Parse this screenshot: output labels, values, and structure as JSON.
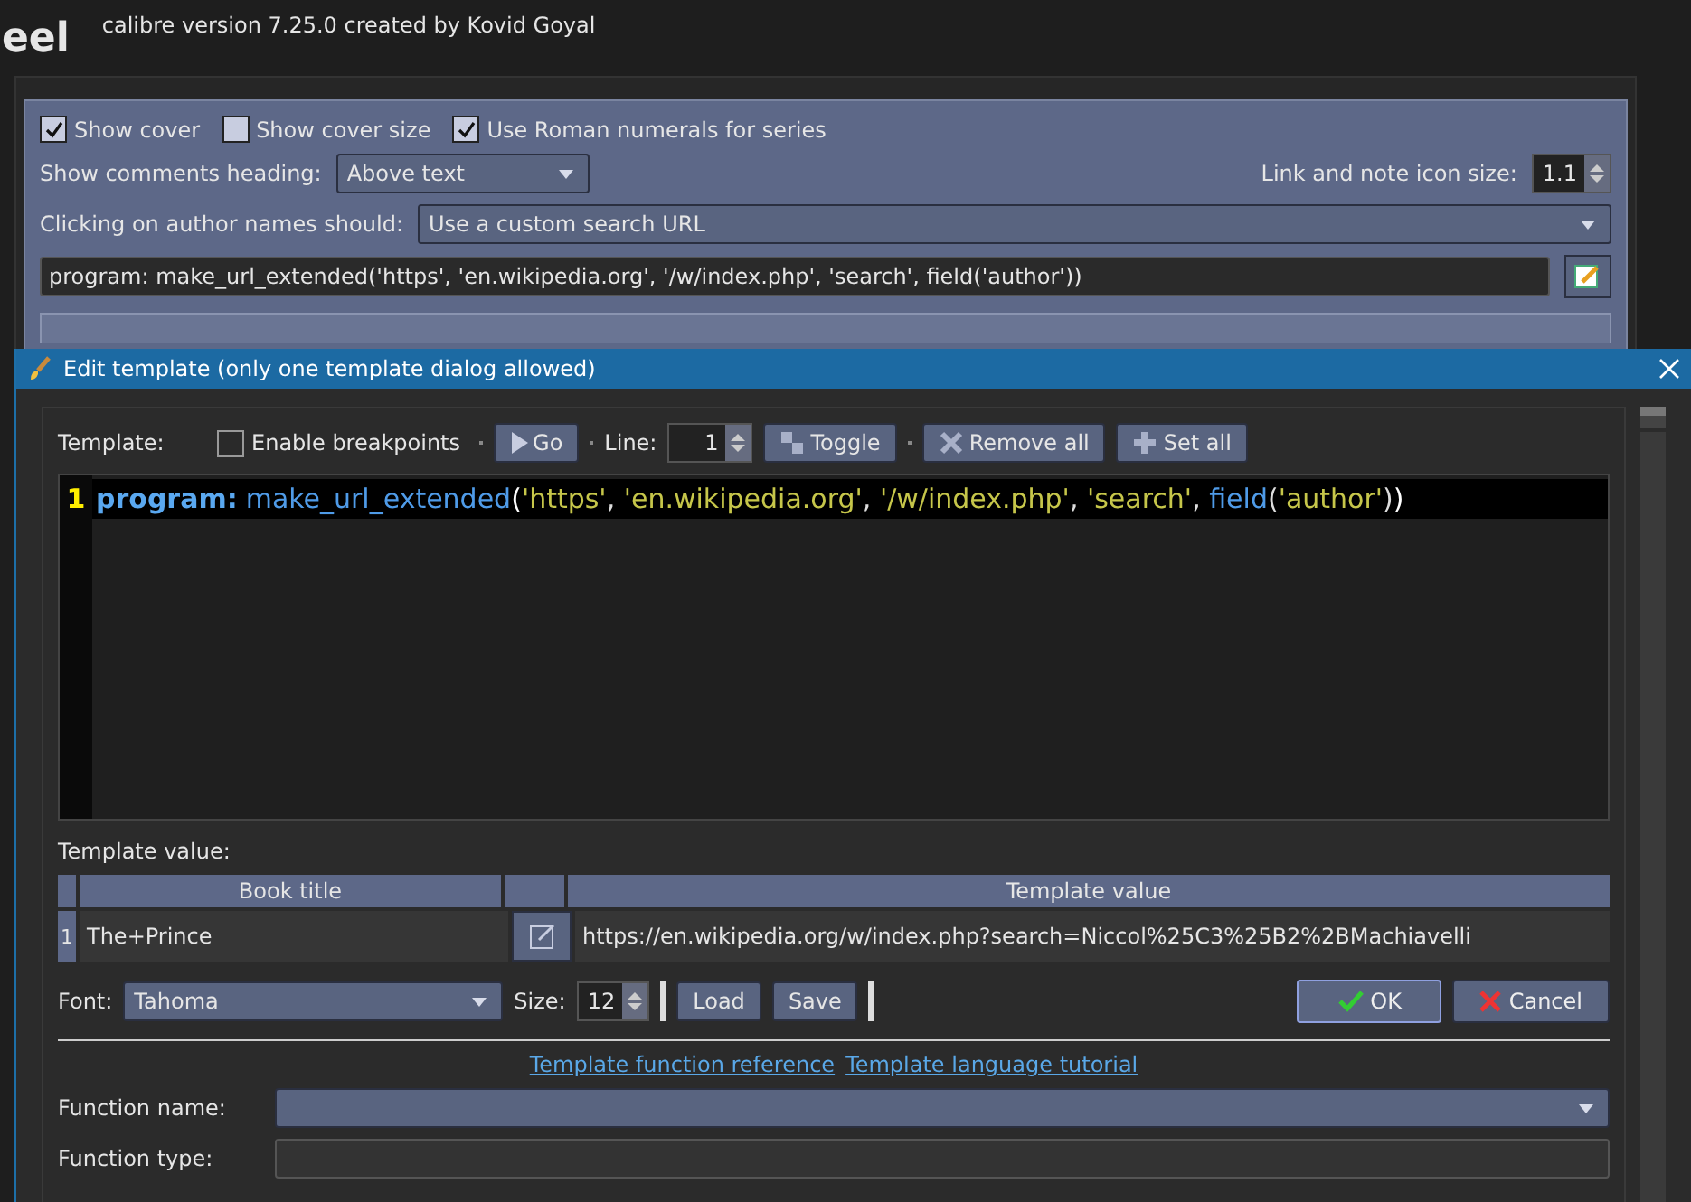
{
  "background_window": {
    "title_fragment": "eel",
    "subtitle": "calibre version 7.25.0 created by Kovid Goyal",
    "checkboxes": [
      {
        "label": "Show cover",
        "checked": true
      },
      {
        "label": "Show cover size",
        "checked": false
      },
      {
        "label": "Use Roman numerals for series",
        "checked": true
      }
    ],
    "comments_heading": {
      "label": "Show comments heading:",
      "value": "Above text"
    },
    "icon_size": {
      "label": "Link and note icon size:",
      "value": "1.1"
    },
    "author_click": {
      "label": "Clicking on author names should:",
      "value": "Use a custom search URL"
    },
    "template_field": {
      "value": "program: make_url_extended('https', 'en.wikipedia.org', '/w/index.php', 'search', field('author'))"
    }
  },
  "dialog": {
    "title": "Edit template (only one template dialog allowed)",
    "toolbar": {
      "label": "Template:",
      "breakpoints": {
        "label": "Enable breakpoints",
        "checked": false
      },
      "go": "Go",
      "line_label": "Line:",
      "line_value": "1",
      "toggle": "Toggle",
      "remove_all": "Remove all",
      "set_all": "Set all"
    },
    "editor": {
      "line_number": "1",
      "tokens": [
        {
          "kind": "keyword",
          "text": "program:"
        },
        {
          "kind": "name",
          "text": "make_url_extended"
        },
        {
          "kind": "paren",
          "text": "("
        },
        {
          "kind": "string",
          "text": "'https'"
        },
        {
          "kind": "plain",
          "text": ", "
        },
        {
          "kind": "string",
          "text": "'en.wikipedia.org'"
        },
        {
          "kind": "plain",
          "text": ", "
        },
        {
          "kind": "string",
          "text": "'/w/index.php'"
        },
        {
          "kind": "plain",
          "text": ", "
        },
        {
          "kind": "string",
          "text": "'search'"
        },
        {
          "kind": "plain",
          "text": ", "
        },
        {
          "kind": "name",
          "text": "field"
        },
        {
          "kind": "plain",
          "text": "("
        },
        {
          "kind": "string",
          "text": "'author'"
        },
        {
          "kind": "plain",
          "text": ")"
        },
        {
          "kind": "paren",
          "text": ")"
        }
      ]
    },
    "value_label": "Template value:",
    "table": {
      "columns": [
        "Book title",
        "Template value"
      ],
      "rows": [
        {
          "number": "1",
          "book_title": "The+Prince",
          "template_value": "https://en.wikipedia.org/w/index.php?search=Niccol%25C3%25B2%2BMachiavelli"
        }
      ]
    },
    "font": {
      "label": "Font:",
      "value": "Tahoma",
      "size_label": "Size:",
      "size": "12",
      "load": "Load",
      "save": "Save"
    },
    "buttons": [
      {
        "label": "OK",
        "kind": "ok"
      },
      {
        "label": "Cancel",
        "kind": "cancel"
      }
    ],
    "links": [
      "Template function reference",
      "Template language tutorial"
    ],
    "function_name": {
      "label": "Function name:"
    },
    "function_type": {
      "label": "Function type:"
    }
  }
}
